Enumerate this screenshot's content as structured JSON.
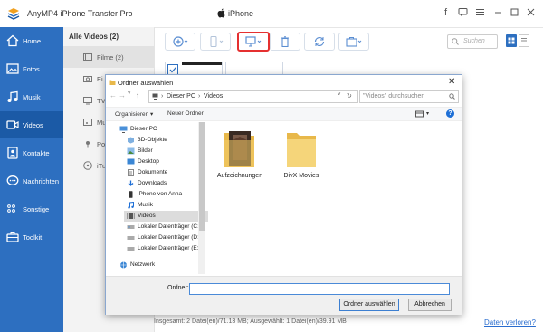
{
  "app": {
    "title": "AnyMP4 iPhone Transfer Pro",
    "device": "iPhone"
  },
  "sidebar": {
    "items": [
      {
        "label": "Home",
        "icon": "home-icon"
      },
      {
        "label": "Fotos",
        "icon": "photo-icon"
      },
      {
        "label": "Musik",
        "icon": "music-icon"
      },
      {
        "label": "Videos",
        "icon": "video-icon",
        "active": true
      },
      {
        "label": "Kontakte",
        "icon": "contacts-icon"
      },
      {
        "label": "Nachrichten",
        "icon": "message-icon"
      },
      {
        "label": "Sonstige",
        "icon": "other-icon"
      },
      {
        "label": "Toolkit",
        "icon": "toolkit-icon"
      }
    ]
  },
  "categories": {
    "header": "Alle Videos (2)",
    "items": [
      {
        "label": "Filme (2)"
      },
      {
        "label": "Ei"
      },
      {
        "label": "TV"
      },
      {
        "label": "Mu"
      },
      {
        "label": "Po"
      },
      {
        "label": "iTu"
      }
    ]
  },
  "search": {
    "placeholder": "Suchen"
  },
  "status": {
    "summary": "Insgesamt: 2 Datei(en)/71.13 MB; Ausgewählt: 1 Datei(en)/39.91 MB",
    "lost_link": "Daten verloren?"
  },
  "dialog": {
    "title": "Ordner auswählen",
    "path": [
      "Dieser PC",
      "Videos"
    ],
    "search_placeholder": "\"Videos\" durchsuchen",
    "organize": "Organisieren ▾",
    "new_folder": "Neuer Ordner",
    "tree": [
      {
        "label": "Dieser PC"
      },
      {
        "label": "3D-Objekte"
      },
      {
        "label": "Bilder"
      },
      {
        "label": "Desktop"
      },
      {
        "label": "Dokumente"
      },
      {
        "label": "Downloads"
      },
      {
        "label": "iPhone von Anna"
      },
      {
        "label": "Musik"
      },
      {
        "label": "Videos",
        "selected": true
      },
      {
        "label": "Lokaler Datenträger (C:)"
      },
      {
        "label": "Lokaler Datenträger (D:)"
      },
      {
        "label": "Lokaler Datenträger (E:)"
      },
      {
        "label": "Netzwerk"
      }
    ],
    "folders": [
      {
        "label": "Aufzeichnungen"
      },
      {
        "label": "DivX Movies"
      }
    ],
    "folder_label": "Ordner:",
    "folder_value": "",
    "select_button": "Ordner auswählen",
    "cancel_button": "Abbrechen"
  },
  "colors": {
    "sidebar": "#2d6fc0",
    "sidebar_active": "#1b5aa6",
    "accent_red": "#e53030",
    "link": "#2a6dcf"
  }
}
